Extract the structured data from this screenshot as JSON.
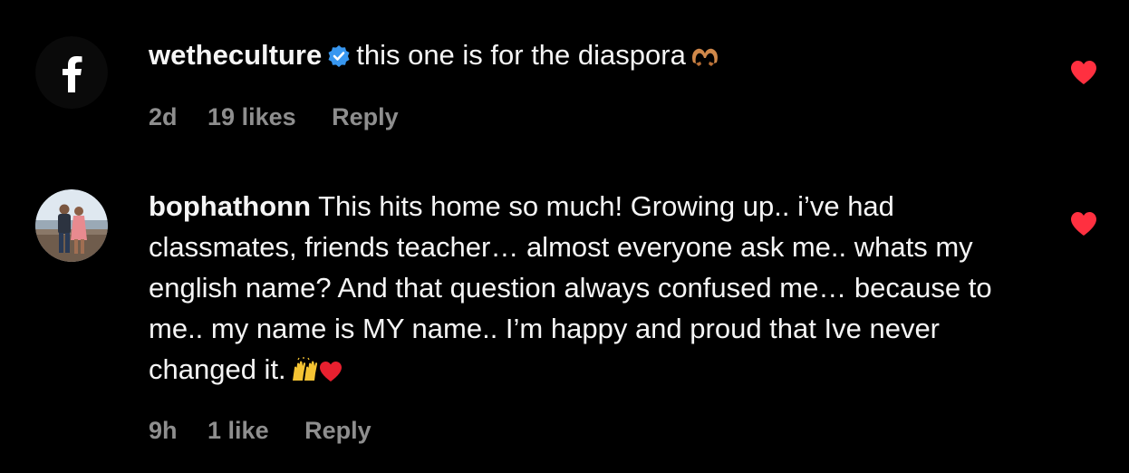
{
  "comments": [
    {
      "username": "wetheculture",
      "verified": true,
      "avatar_icon": "facebook-f-icon",
      "text": "this one is for the diaspora",
      "text_emoji": "heart-hands-emoji",
      "time": "2d",
      "likes": "19 likes",
      "reply_label": "Reply",
      "liked": true
    },
    {
      "username": "bophathonn",
      "verified": false,
      "avatar_icon": "profile-photo",
      "text": "This hits home so much! Growing up.. i’ve had classmates, friends teacher… almost everyone ask me.. whats my english name? And that question always confused me… because to me.. my name is MY name.. I’m happy and proud that Ive never changed it.",
      "text_emoji": "raised-hands-and-red-heart-emoji",
      "time": "9h",
      "likes": "1 like",
      "reply_label": "Reply",
      "liked": true
    }
  ],
  "colors": {
    "background": "#000000",
    "text": "#f5f5f5",
    "meta": "#8e8e8e",
    "verified": "#3897f0",
    "heart": "#ff3040"
  }
}
